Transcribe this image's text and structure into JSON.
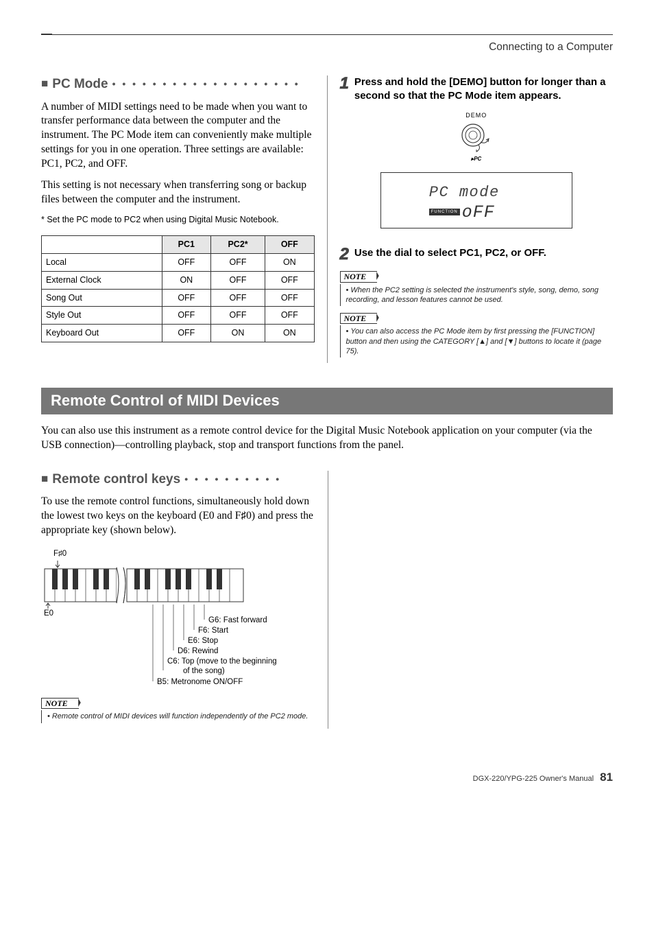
{
  "header": {
    "breadcrumb": "Connecting to a Computer"
  },
  "pcmode": {
    "heading_prefix": "■",
    "heading": "PC Mode",
    "para1": "A number of MIDI settings need to be made when you want to transfer performance data between the computer and the instrument. The PC Mode item can conveniently make multiple settings for you in one operation. Three settings are available: PC1, PC2, and OFF.",
    "para2": "This setting is not necessary when transferring song or backup files between the computer and the instrument.",
    "footnote": "* Set the PC mode to PC2 when using Digital Music Notebook.",
    "table": {
      "headers": [
        "",
        "PC1",
        "PC2*",
        "OFF"
      ],
      "rows": [
        [
          "Local",
          "OFF",
          "OFF",
          "ON"
        ],
        [
          "External Clock",
          "ON",
          "OFF",
          "OFF"
        ],
        [
          "Song Out",
          "OFF",
          "OFF",
          "OFF"
        ],
        [
          "Style Out",
          "OFF",
          "OFF",
          "OFF"
        ],
        [
          "Keyboard Out",
          "OFF",
          "ON",
          "ON"
        ]
      ]
    }
  },
  "steps": {
    "s1_num": "1",
    "s1_text": "Press and hold the [DEMO] button for longer than a second so that the PC Mode item appears.",
    "demo_label": "DEMO",
    "pc_sub": "PC",
    "lcd_top": "PC mode",
    "lcd_func": "FUNCTION",
    "lcd_bottom": "oFF",
    "s2_num": "2",
    "s2_text": "Use the dial to select PC1, PC2, or OFF."
  },
  "notes": {
    "n1_label": "NOTE",
    "n1_text": "When the PC2 setting is selected the instrument's style, song, demo, song recording, and lesson features cannot be used.",
    "n2_label": "NOTE",
    "n2_text_a": "You can also access the PC Mode item by first pressing the [FUNCTION] button and then using the CATEGORY [",
    "n2_text_b": "] and [",
    "n2_text_c": "] buttons to locate it (page 75).",
    "n3_label": "NOTE",
    "n3_text": "Remote control of MIDI devices will function independently of the PC2 mode."
  },
  "remote": {
    "bar": "Remote Control of MIDI Devices",
    "intro": "You can also use this instrument as a remote control device for the Digital Music Notebook application on your computer (via the USB connection)—controlling playback, stop and transport functions from the panel.",
    "heading_prefix": "■",
    "heading": "Remote control keys",
    "para": "To use the remote control functions, simultaneously hold down the lowest two keys on the keyboard (E0 and F♯0) and press the appropriate key (shown below).",
    "labels": {
      "fsharp0": "F♯0",
      "e0": "E0",
      "g6": "G6: Fast forward",
      "f6": "F6: Start",
      "e6": "E6: Stop",
      "d6": "D6: Rewind",
      "c6a": "C6: Top (move to the beginning",
      "c6b": "of the song)",
      "b5": "B5: Metronome ON/OFF"
    }
  },
  "footer": {
    "manual": "DGX-220/YPG-225  Owner's Manual",
    "page": "81"
  }
}
